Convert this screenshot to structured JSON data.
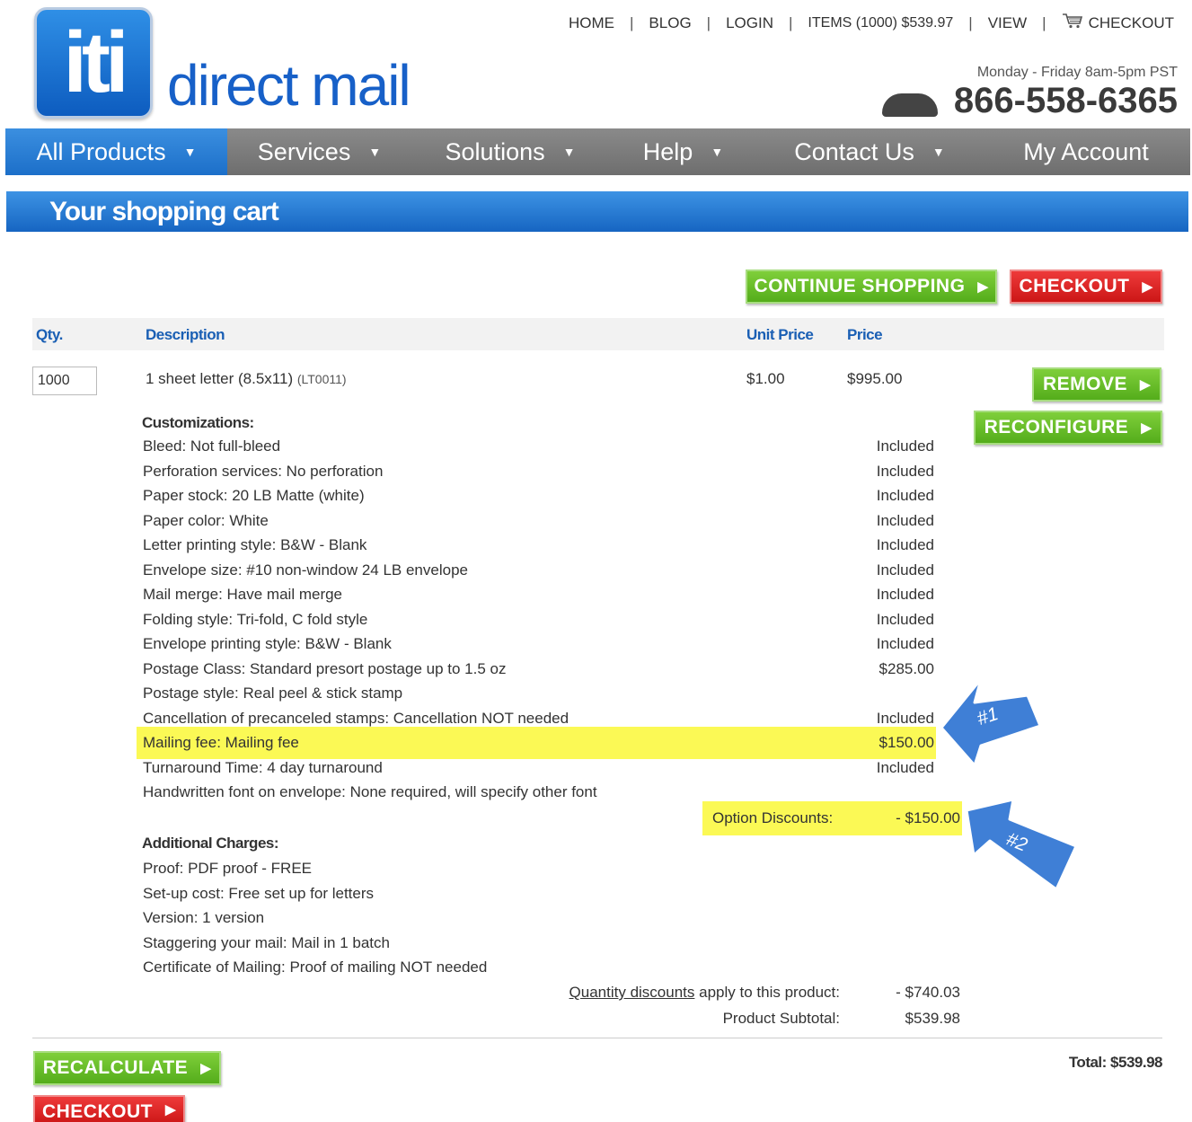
{
  "header": {
    "logo_mark": "iti",
    "logo_text": "direct mail",
    "top_links": {
      "home": "HOME",
      "blog": "BLOG",
      "login": "LOGIN",
      "items": "ITEMS (1000) $539.97",
      "view": "VIEW",
      "checkout": "CHECKOUT",
      "separator": "|"
    },
    "hours": "Monday - Friday 8am-5pm PST",
    "phone": "866-558-6365"
  },
  "nav": {
    "items": [
      {
        "label": "All Products"
      },
      {
        "label": "Services"
      },
      {
        "label": "Solutions"
      },
      {
        "label": "Help"
      },
      {
        "label": "Contact Us"
      },
      {
        "label": "My Account"
      }
    ],
    "caret": "▼"
  },
  "banner": "Your shopping cart",
  "buttons": {
    "continue_shopping": "CONTINUE SHOPPING",
    "checkout": "CHECKOUT",
    "remove": "REMOVE",
    "reconfigure": "RECONFIGURE",
    "recalculate": "RECALCULATE",
    "checkout_bottom": "CHECKOUT",
    "arrow": "▶"
  },
  "table": {
    "headers": {
      "qty": "Qty.",
      "description": "Description",
      "unit_price": "Unit Price",
      "price": "Price"
    },
    "item": {
      "qty": "1000",
      "name": "1 sheet letter (8.5x11)",
      "code": "(LT0011)",
      "unit_price": "$1.00",
      "price": "$995.00"
    }
  },
  "customizations": {
    "heading": "Customizations:",
    "rows": [
      {
        "label": "Bleed:  Not full-bleed",
        "value": "Included"
      },
      {
        "label": "Perforation services:  No perforation",
        "value": "Included"
      },
      {
        "label": "Paper stock:  20 LB Matte (white)",
        "value": "Included"
      },
      {
        "label": "Paper color:  White",
        "value": "Included"
      },
      {
        "label": "Letter printing style:  B&W - Blank",
        "value": "Included"
      },
      {
        "label": "Envelope size:  #10 non-window 24 LB envelope",
        "value": "Included"
      },
      {
        "label": "Mail merge:  Have mail merge",
        "value": "Included"
      },
      {
        "label": "Folding style:  Tri-fold, C fold style",
        "value": "Included"
      },
      {
        "label": "Envelope printing style:  B&W - Blank",
        "value": "Included"
      },
      {
        "label": "Postage Class:  Standard presort postage up to 1.5 oz",
        "value": "$285.00"
      },
      {
        "label": "Postage style:  Real peel & stick stamp",
        "value": ""
      },
      {
        "label": "Cancellation of precanceled stamps:  Cancellation NOT needed",
        "value": "Included"
      },
      {
        "label": "Mailing fee:  Mailing fee",
        "value": "$150.00"
      },
      {
        "label": "Turnaround Time:  4 day turnaround",
        "value": "Included"
      },
      {
        "label": "Handwritten font on envelope:  None required, will specify other font",
        "value": ""
      }
    ],
    "highlight_color": "#fbf955"
  },
  "option_discounts": {
    "label": "Option Discounts:",
    "value": "- $150.00"
  },
  "additional": {
    "heading": "Additional Charges:",
    "rows": [
      "Proof: PDF proof - FREE",
      "Set-up cost: Free set up for letters",
      "Version: 1 version",
      "Staggering your mail: Mail in 1 batch",
      "Certificate of Mailing: Proof of mailing NOT needed"
    ]
  },
  "summary": {
    "quantity_discounts_link": "Quantity discounts",
    "quantity_discounts_rest": " apply to this product:",
    "quantity_discounts_value": "- $740.03",
    "subtotal_label": "Product Subtotal:",
    "subtotal_value": "$539.98",
    "total": "Total: $539.98"
  },
  "callouts": {
    "first": "#1",
    "second": "#2",
    "color": "#3f7fd6"
  },
  "colors": {
    "brand_blue": "#1760c8",
    "green": "#5bb521",
    "red": "#d91e1e",
    "nav_gray": "#7a7a7a"
  }
}
